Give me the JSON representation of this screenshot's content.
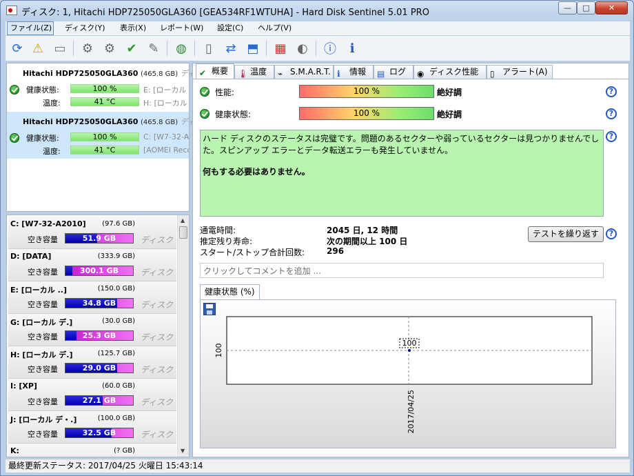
{
  "window": {
    "title": "ディスク: 1, Hitachi HDP725050GLA360 [GEA534RF1WTUHA]  -  Hard Disk Sentinel 5.01 PRO",
    "buttons": {
      "min": "—",
      "max": "□",
      "close": "✕"
    }
  },
  "menu": [
    "ファイル(Z)",
    "ディスク(Y)",
    "表示(X)",
    "レポート(W)",
    "設定(C)",
    "ヘルプ(V)"
  ],
  "toolbar_icons": [
    "refresh-icon",
    "warning-icon",
    "disk-icon",
    "probe-icon",
    "probe-icon-2",
    "probe-check-icon",
    "probe-icon-3",
    "globe-icon",
    "document-icon",
    "transfer-icon",
    "network-icon",
    "report-icon",
    "speaker-icon",
    "help-icon",
    "info-icon"
  ],
  "disks": [
    {
      "name": "Hitachi HDP725050GLA360",
      "size": "(465.8 GB)",
      "extra": "ディ",
      "health_label": "健康状態:",
      "health": "100 %",
      "temp_label": "温度:",
      "temp": "41 °C",
      "side1": "E: [ローカル ]",
      "side2": "H: [ローカル"
    },
    {
      "name": "Hitachi HDP725050GLA360",
      "size": "(465.8 GB)",
      "extra": "ディ",
      "health_label": "健康状態:",
      "health": "100 %",
      "temp_label": "温度:",
      "temp": "41 °C",
      "side1": "C: [W7-32-A2",
      "side2": "[AOMEI Reco"
    }
  ],
  "partitions": [
    {
      "name": "C: [W7-32-A2010]",
      "size": "(97.6 GB)",
      "free_label": "空き容量",
      "free": "51.9 GB",
      "used_pct": 47,
      "disk": "ディスク"
    },
    {
      "name": "D: [DATA]",
      "size": "(333.9 GB)",
      "free_label": "空き容量",
      "free": "300.1 GB",
      "used_pct": 10,
      "disk": "ディスク"
    },
    {
      "name": "E: [ローカル ..]",
      "size": "(150.0 GB)",
      "free_label": "空き容量",
      "free": "34.8 GB",
      "used_pct": 77,
      "disk": "ディスク"
    },
    {
      "name": "G: [ローカル デ.]",
      "size": "(30.0 GB)",
      "free_label": "空き容量",
      "free": "25.3 GB",
      "used_pct": 16,
      "disk": "ディスク"
    },
    {
      "name": "H: [ローカル デ.]",
      "size": "(125.7 GB)",
      "free_label": "空き容量",
      "free": "29.0 GB",
      "used_pct": 77,
      "disk": "ディスク"
    },
    {
      "name": "I: [XP]",
      "size": "(60.0 GB)",
      "free_label": "空き容量",
      "free": "27.1 GB",
      "used_pct": 55,
      "disk": "ディスク"
    },
    {
      "name": "J: [ローカル デ・.]",
      "size": "(100.0 GB)",
      "free_label": "空き容量",
      "free": "32.5 GB",
      "used_pct": 68,
      "disk": "ディスク"
    },
    {
      "name": "K:",
      "size": "(? GB)",
      "free_label": "",
      "free": "",
      "used_pct": 0,
      "disk": ""
    }
  ],
  "tabs": [
    {
      "label": "概要",
      "icon": "✔"
    },
    {
      "label": "温度",
      "icon": "🌡"
    },
    {
      "label": "S.M.A.R.T.",
      "icon": "⌁"
    },
    {
      "label": "情報",
      "icon": "ℹ"
    },
    {
      "label": "ログ",
      "icon": "▤"
    },
    {
      "label": "ディスク性能",
      "icon": "◉"
    },
    {
      "label": "アラート(A)",
      "icon": "▯"
    }
  ],
  "overview": {
    "performance_label": "性能:",
    "performance_value": "100 %",
    "performance_pct": 100,
    "performance_status": "絶好調",
    "health_label": "健康状態:",
    "health_value": "100 %",
    "health_pct": 100,
    "health_status": "絶好調",
    "message_line1": "ハード ディスクのステータスは完璧です。問題のあるセクターや弱っているセクターは見つかりませんでした。スピンアップ エラーとデータ転送エラーも発生していません。",
    "message_line2": "何もする必要はありません。",
    "power_on_label": "通電時間:",
    "power_on_value": "2045 日, 12 時間",
    "lifetime_label": "推定残り寿命:",
    "lifetime_value": "次の期間以上 100 日",
    "startstop_label": "スタート/ストップ合計回数:",
    "startstop_value": "296",
    "retest_button": "テストを繰り返す",
    "comment_placeholder": "クリックしてコメントを追加 ..."
  },
  "chart_tab": "健康状態 (%)",
  "chart_data": {
    "type": "line",
    "x": [
      "2017/04/25"
    ],
    "series": [
      {
        "values": [
          100
        ]
      }
    ],
    "ylabel": "",
    "xlabel": "",
    "point_label": "100",
    "ytick": "100",
    "xtick": "2017/04/25"
  },
  "statusbar": "最終更新ステータス: 2017/04/25 火曜日 15:43:14",
  "colors": {
    "accent": "#1f55c8",
    "ok": "#127d12",
    "message_bg": "#b9f5b0"
  }
}
